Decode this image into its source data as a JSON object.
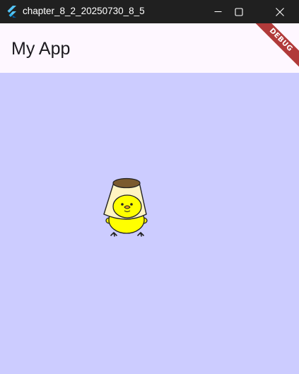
{
  "window": {
    "title": "chapter_8_2_20250730_8_5",
    "icon": "flutter-logo-icon",
    "controls": [
      "minimize-icon",
      "maximize-icon",
      "close-icon"
    ]
  },
  "appbar": {
    "title": "My App",
    "background": "#fef7ff"
  },
  "content": {
    "background": "#ccccff",
    "image": "chick-with-pudding-hat"
  },
  "debug_banner": {
    "label": "DEBUG",
    "color": "#b13a3a"
  }
}
